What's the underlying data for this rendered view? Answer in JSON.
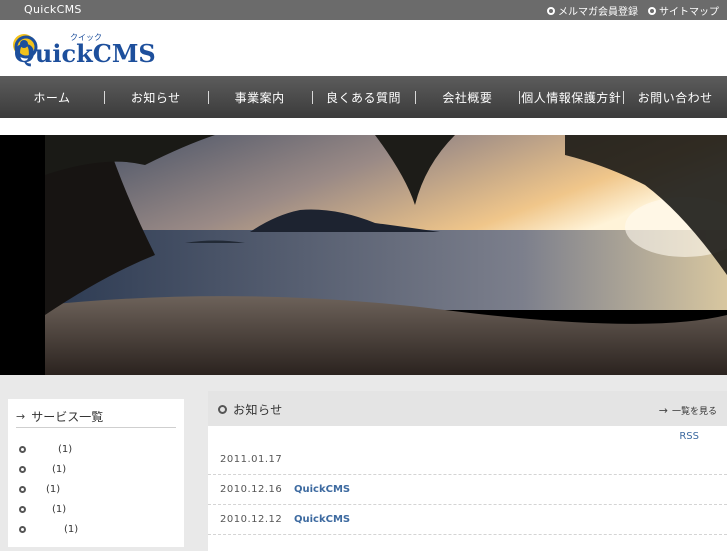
{
  "topbar": {
    "site_name": "QuickCMS",
    "links": [
      {
        "label": "メルマガ会員登録",
        "icon": "ring-icon"
      },
      {
        "label": "サイトマップ",
        "icon": "ring-icon"
      }
    ]
  },
  "logo": {
    "kana": "クイック",
    "text": "QuickCMS"
  },
  "nav": {
    "items": [
      "ホーム",
      "お知らせ",
      "事業案内",
      "良くある質問",
      "会社概要",
      "個人情報保護方針",
      "お問い合わせ"
    ]
  },
  "sidebar": {
    "title": "サービス一覧",
    "items": [
      {
        "label": "",
        "count": "(1)"
      },
      {
        "label": "",
        "count": "(1)"
      },
      {
        "label": "",
        "count": "(1)"
      },
      {
        "label": "",
        "count": "(1)"
      },
      {
        "label": "",
        "count": "(1)"
      }
    ]
  },
  "news": {
    "title": "お知らせ",
    "more_label": "一覧を見る",
    "rss_label": "RSS",
    "rows": [
      {
        "date": "2011.01.17",
        "title": ""
      },
      {
        "date": "2010.12.16",
        "title": "QuickCMS"
      },
      {
        "date": "2010.12.12",
        "title": "QuickCMS"
      }
    ]
  },
  "colors": {
    "nav_bg": "#4a4a4a",
    "link": "#3d6aa0",
    "topbar": "#6b6b6b"
  }
}
